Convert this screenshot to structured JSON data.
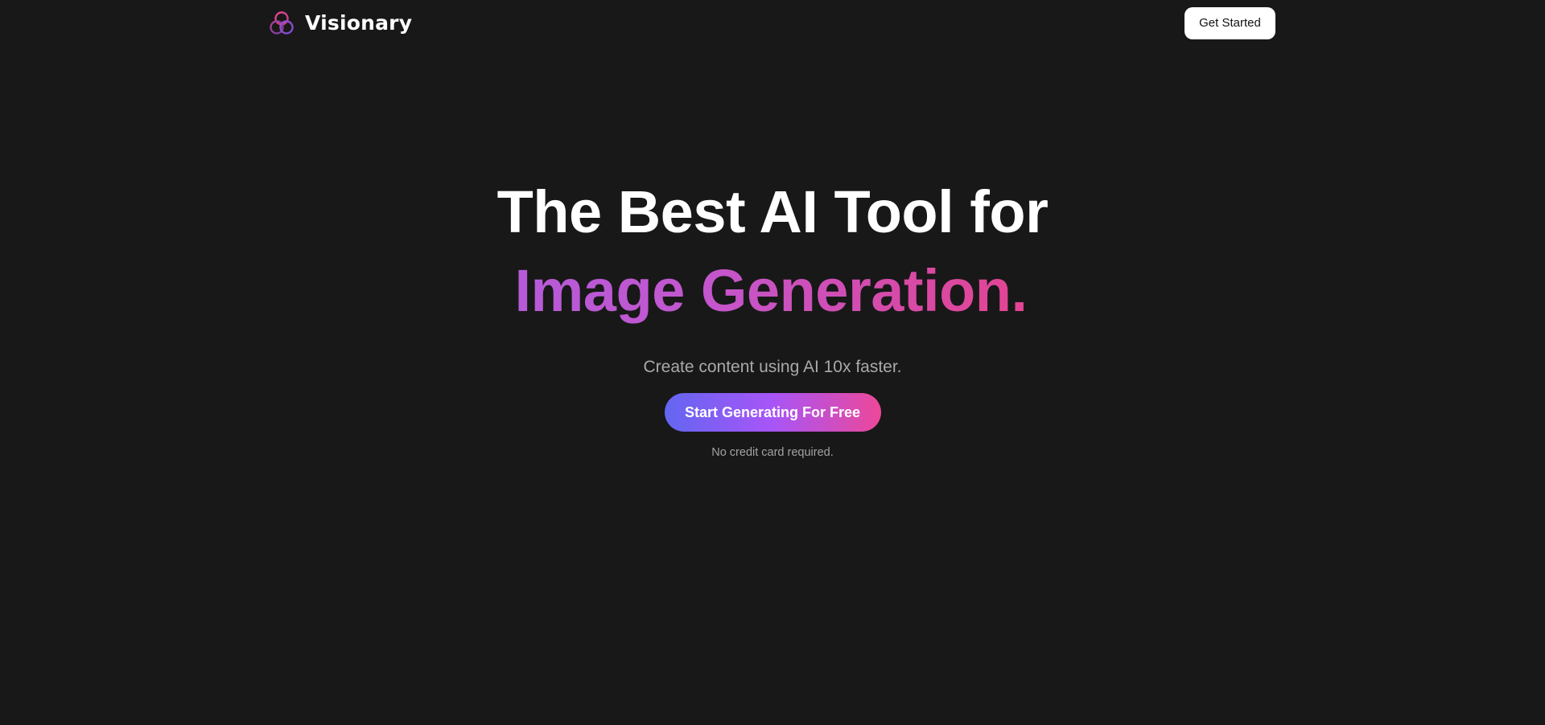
{
  "nav": {
    "brand_name": "Visionary",
    "logo_icon": "three-rings-logo-icon",
    "cta_label": "Get Started"
  },
  "hero": {
    "headline_line1": "The Best AI Tool for",
    "headline_line2": "Image Generation.",
    "subtitle": "Create content using AI 10x faster.",
    "cta_label": "Start Generating For Free",
    "note": "No credit card required."
  },
  "colors": {
    "background": "#181818",
    "accent_gradient_start": "#6366f1",
    "accent_gradient_mid": "#a855f7",
    "accent_gradient_end": "#ec4899",
    "headline_gradient_start": "#b65ad8",
    "headline_gradient_end": "#e44492"
  }
}
